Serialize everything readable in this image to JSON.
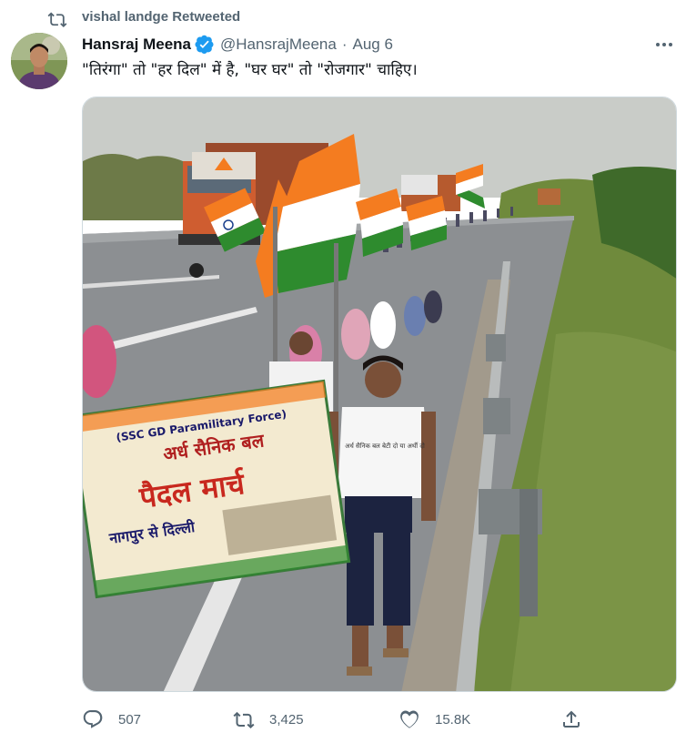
{
  "retweet": {
    "label": "vishal landge Retweeted",
    "icon": "retweet-icon"
  },
  "author": {
    "name": "Hansraj Meena",
    "handle": "@HansrajMeena",
    "separator": "·",
    "date": "Aug 6",
    "verified": true
  },
  "tweet": {
    "text": "\"तिरंगा\" तो \"हर दिल\" में है, \"घर घर\" तो \"रोजगार\" चाहिए।"
  },
  "media": {
    "description_icon": "photo",
    "banner_lines": [
      "(SSC GD Paramilitary Force)",
      "अर्ध सैनिक बल",
      "पैदल मार्च",
      "नागपुर से दिल्ली"
    ],
    "shirt_text": "अर्ध सैनिक बल बेटी दो या अर्थी दो"
  },
  "actions": {
    "reply": {
      "count": "507",
      "icon": "reply-icon"
    },
    "retweet": {
      "count": "3,425",
      "icon": "retweet-icon"
    },
    "like": {
      "count": "15.8K",
      "icon": "heart-icon"
    },
    "share": {
      "icon": "share-icon"
    }
  },
  "colors": {
    "muted": "#536471",
    "text": "#0f1419",
    "verified": "#1d9bf0",
    "saffron": "#f47c20",
    "green": "#2e8b2e"
  }
}
